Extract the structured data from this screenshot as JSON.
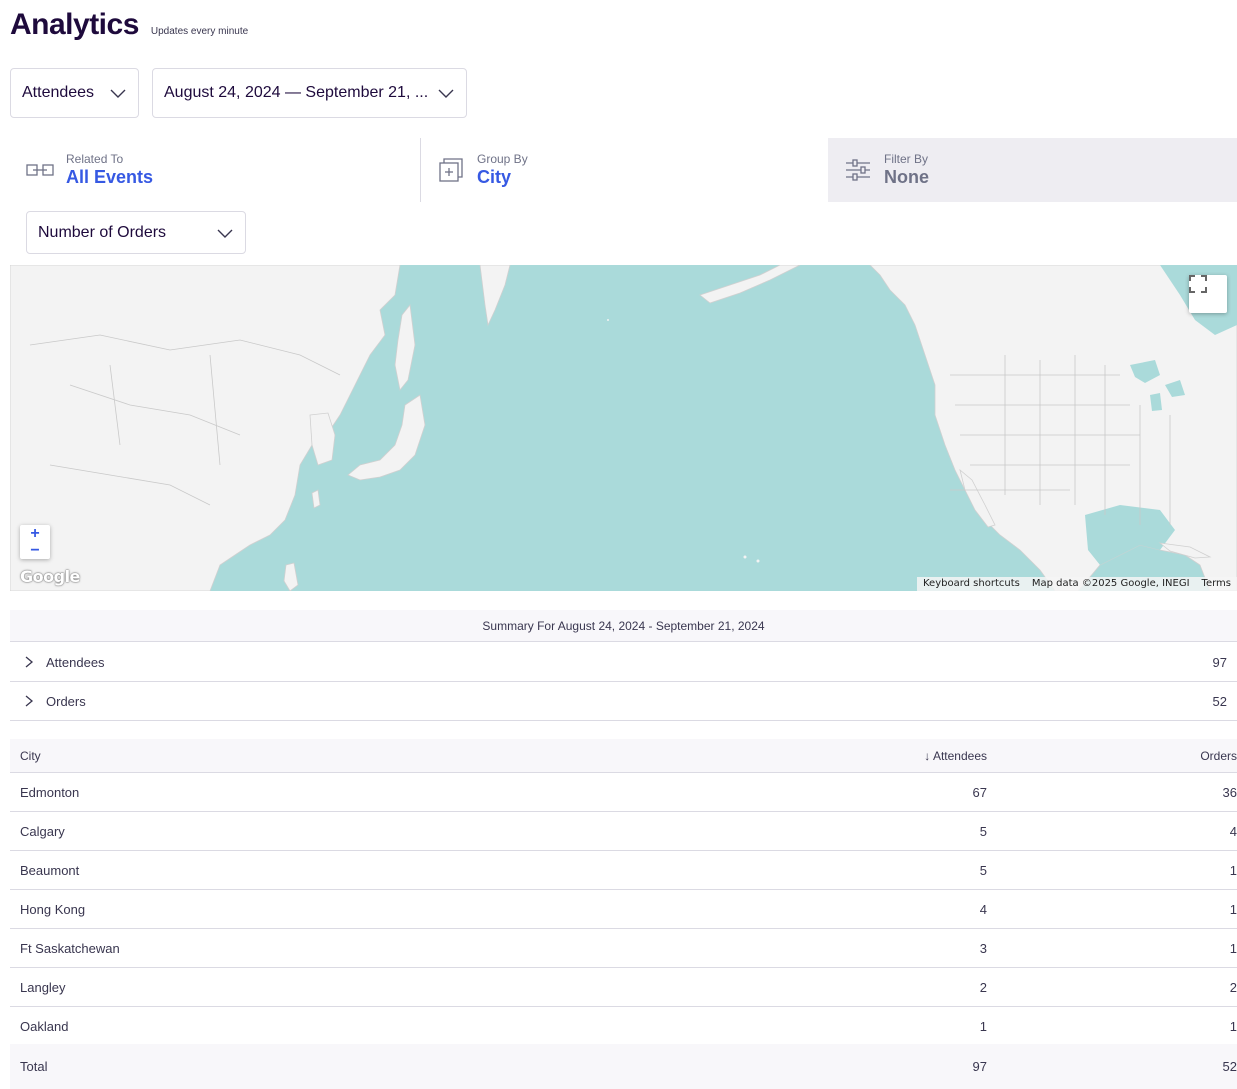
{
  "header": {
    "title": "Analytics",
    "subtitle": "Updates every minute"
  },
  "controls": {
    "metric_select": "Attendees",
    "date_range_select": "August 24, 2024 — September 21, ...",
    "measure_select": "Number of Orders"
  },
  "filters": {
    "related_to": {
      "label": "Related To",
      "value": "All Events",
      "icon": "link-icon"
    },
    "group_by": {
      "label": "Group By",
      "value": "City",
      "icon": "group-plus-icon"
    },
    "filter_by": {
      "label": "Filter By",
      "value": "None",
      "icon": "sliders-icon"
    }
  },
  "map": {
    "zoom_in": "+",
    "zoom_out": "−",
    "logo": "Google",
    "attribution": {
      "shortcuts": "Keyboard shortcuts",
      "data": "Map data ©2025 Google, INEGI",
      "terms": "Terms"
    },
    "colors": {
      "water": "#aadada",
      "land": "#f3f3f3",
      "border": "#c9c9c9"
    }
  },
  "summary": {
    "title": "Summary For August 24, 2024 - September 21, 2024",
    "rows": [
      {
        "label": "Attendees",
        "value": "97"
      },
      {
        "label": "Orders",
        "value": "52"
      }
    ]
  },
  "table": {
    "columns": [
      "City",
      "↓ Attendees",
      "Orders"
    ],
    "rows": [
      {
        "city": "Edmonton",
        "attendees": "67",
        "orders": "36"
      },
      {
        "city": "Calgary",
        "attendees": "5",
        "orders": "4"
      },
      {
        "city": "Beaumont",
        "attendees": "5",
        "orders": "1"
      },
      {
        "city": "Hong Kong",
        "attendees": "4",
        "orders": "1"
      },
      {
        "city": "Ft Saskatchewan",
        "attendees": "3",
        "orders": "1"
      },
      {
        "city": "Langley",
        "attendees": "2",
        "orders": "2"
      },
      {
        "city": "Oakland",
        "attendees": "1",
        "orders": "1"
      }
    ],
    "total": {
      "label": "Total",
      "attendees": "97",
      "orders": "52"
    }
  },
  "colors": {
    "primary_text": "#1e0a3c",
    "link_blue": "#3659e3",
    "muted": "#6f7287"
  }
}
